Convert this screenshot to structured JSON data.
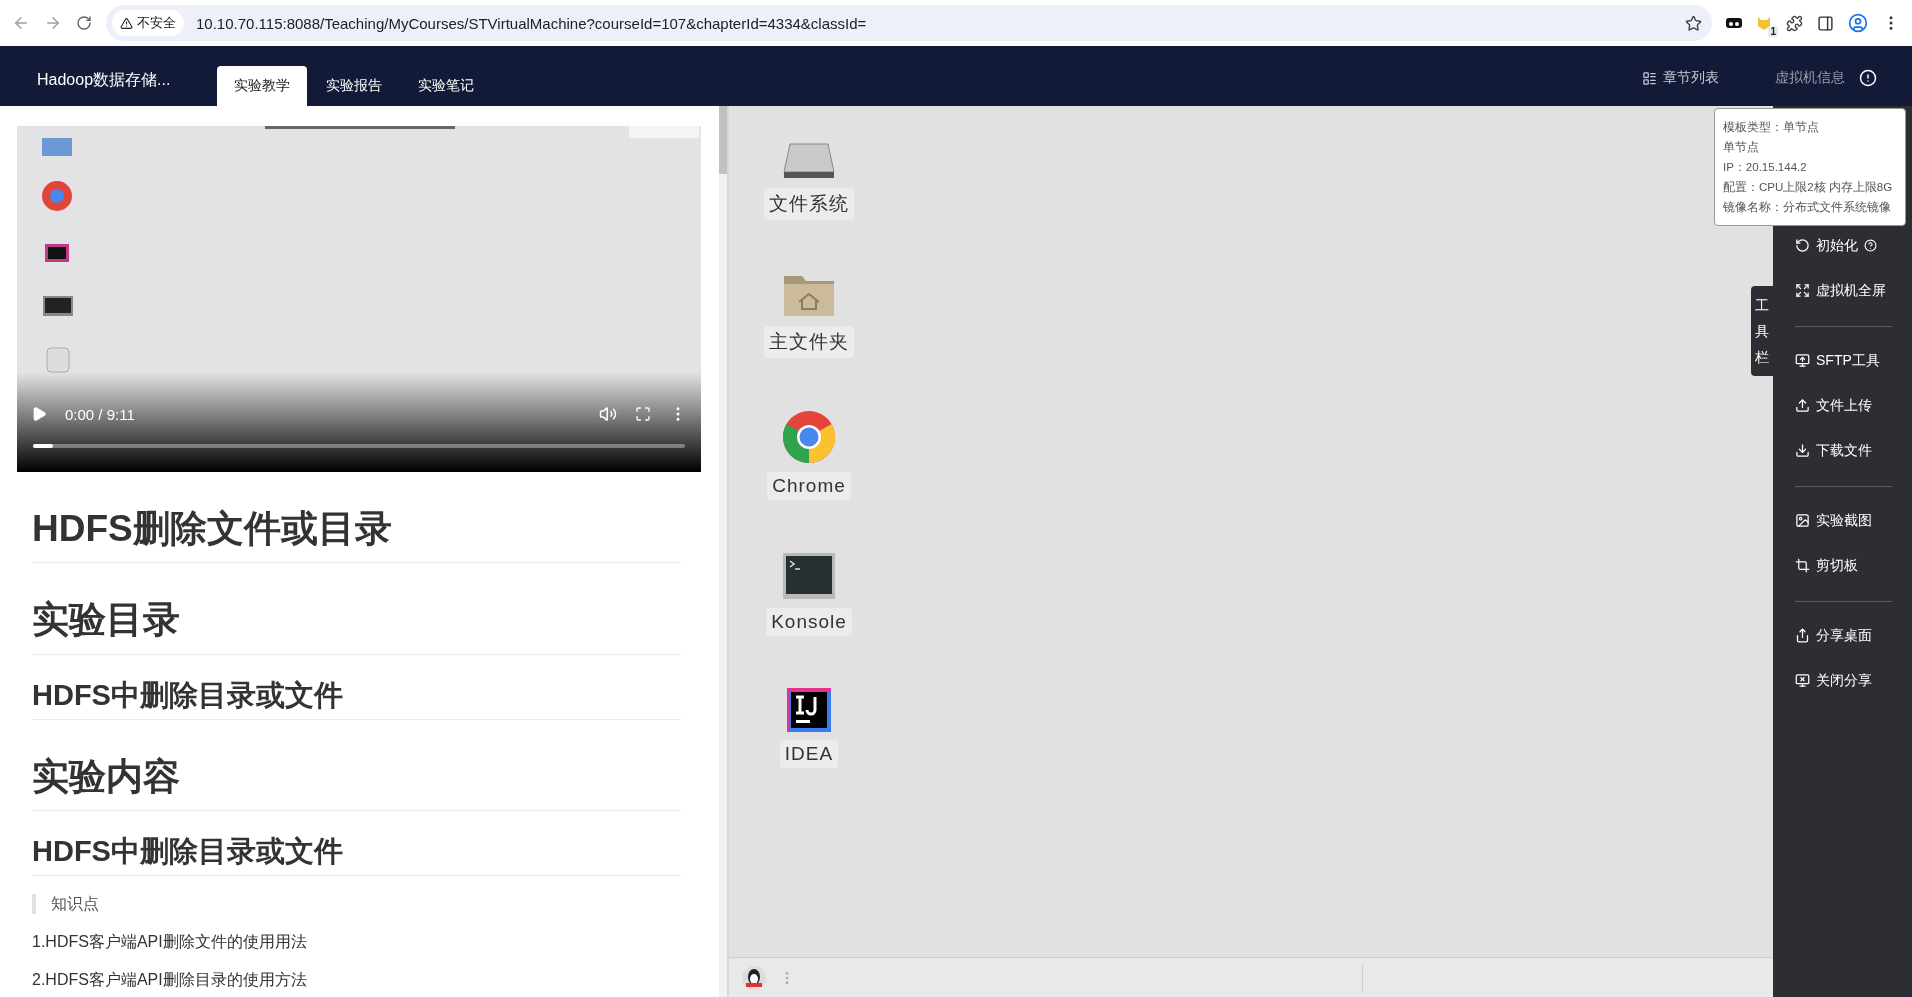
{
  "browser": {
    "security_label": "不安全",
    "url": "10.10.70.115:8088/Teaching/MyCourses/STVirtualMachine?courseId=107&chapterId=4334&classId=",
    "extension_badge": "1"
  },
  "header": {
    "course_title": "Hadoop数据存储...",
    "tabs": [
      {
        "label": "实验教学",
        "selected": true
      },
      {
        "label": "实验报告",
        "selected": false
      },
      {
        "label": "实验笔记",
        "selected": false
      }
    ],
    "chapter_list": "章节列表",
    "vm_info": "虚拟机信息"
  },
  "video": {
    "time": "0:00 / 9:11",
    "level": 0.03
  },
  "content": [
    {
      "kind": "h1",
      "text": "HDFS删除文件或目录"
    },
    {
      "kind": "h1",
      "text": "实验目录"
    },
    {
      "kind": "h2",
      "text": "HDFS中删除目录或文件"
    },
    {
      "kind": "h1",
      "text": "实验内容"
    },
    {
      "kind": "h2",
      "text": "HDFS中删除目录或文件"
    },
    {
      "kind": "quote",
      "text": "知识点"
    },
    {
      "kind": "p",
      "text": "1.HDFS客户端API删除文件的使用用法"
    },
    {
      "kind": "p",
      "text": "2.HDFS客户端API删除目录的使用方法"
    }
  ],
  "desktop_icons": [
    {
      "label": "文件系统",
      "kind": "drive"
    },
    {
      "label": "主文件夹",
      "kind": "folder"
    },
    {
      "label": "Chrome",
      "kind": "chrome"
    },
    {
      "label": "Konsole",
      "kind": "terminal"
    },
    {
      "label": "IDEA",
      "kind": "idea"
    }
  ],
  "vm_tooltip": [
    "模板类型：单节点",
    "单节点",
    "IP：20.15.144.2",
    "配置：CPU上限2核 内存上限8G",
    "镜像名称：分布式文件系统镜像"
  ],
  "toolbar_tab": "工具栏",
  "toolbar_groups": [
    [
      {
        "label": "初始化",
        "kind": "reset",
        "help": true
      },
      {
        "label": "虚拟机全屏",
        "kind": "fullscreen",
        "help": false
      }
    ],
    [
      {
        "label": "SFTP工具",
        "kind": "sftp",
        "help": false
      },
      {
        "label": "文件上传",
        "kind": "upload",
        "help": false
      },
      {
        "label": "下载文件",
        "kind": "download",
        "help": false
      }
    ],
    [
      {
        "label": "实验截图",
        "kind": "screenshot",
        "help": false
      },
      {
        "label": "剪切板",
        "kind": "clipboard",
        "help": false
      }
    ],
    [
      {
        "label": "分享桌面",
        "kind": "share",
        "help": false
      },
      {
        "label": "关闭分享",
        "kind": "unshare",
        "help": false
      }
    ]
  ]
}
